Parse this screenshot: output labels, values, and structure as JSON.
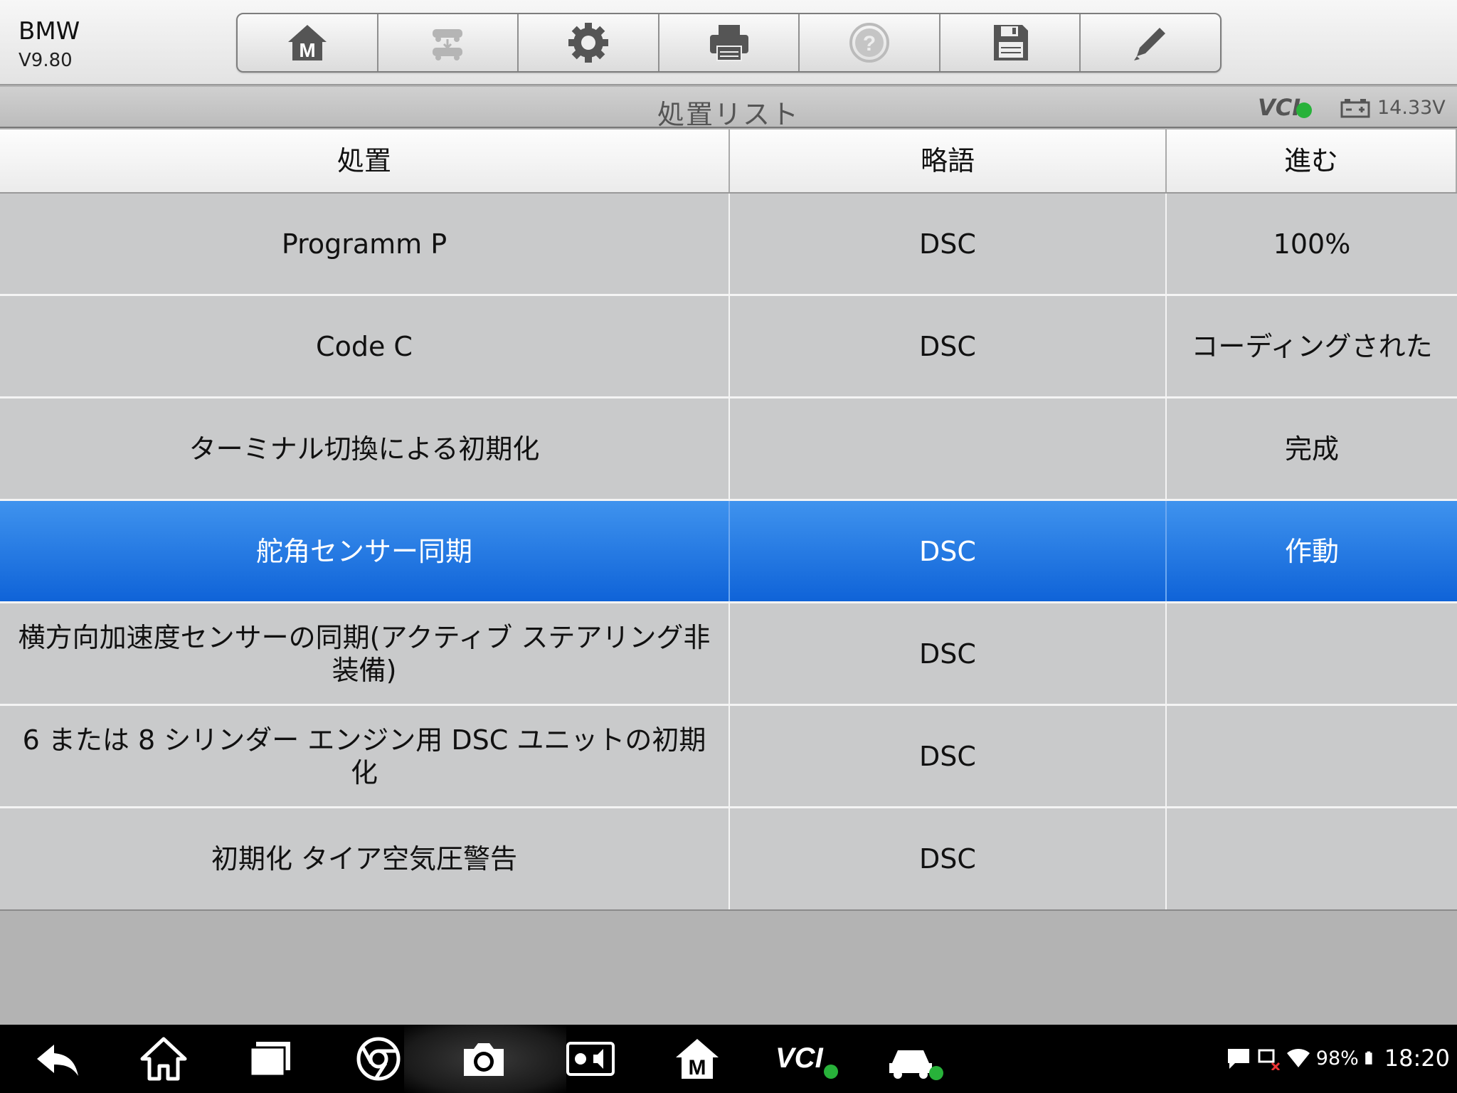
{
  "app": {
    "name": "BMW",
    "version": "V9.80"
  },
  "toolbar": {
    "buttons": [
      {
        "icon": "home-m-icon",
        "enabled": true
      },
      {
        "icon": "vehicle-swap-icon",
        "enabled": false
      },
      {
        "icon": "gear-icon",
        "enabled": true
      },
      {
        "icon": "printer-icon",
        "enabled": true
      },
      {
        "icon": "help-icon",
        "enabled": false
      },
      {
        "icon": "save-icon",
        "enabled": true
      },
      {
        "icon": "pencil-icon",
        "enabled": true
      }
    ]
  },
  "titlebar": {
    "title": "処置リスト",
    "vci_label": "VCI",
    "voltage": "14.33V"
  },
  "table": {
    "headers": [
      "処置",
      "略語",
      "進む"
    ],
    "rows": [
      {
        "action": "Programm P",
        "abbr": "DSC",
        "progress": "100%"
      },
      {
        "action": "Code C",
        "abbr": "DSC",
        "progress": "コーディングされた"
      },
      {
        "action": "ターミナル切換による初期化",
        "abbr": "",
        "progress": "完成"
      },
      {
        "action": "舵角センサー同期",
        "abbr": "DSC",
        "progress": "作動"
      },
      {
        "action": "横方向加速度センサーの同期(アクティブ ステアリング非装備)",
        "abbr": "DSC",
        "progress": ""
      },
      {
        "action": "6 または 8 シリンダー エンジン用 DSC ユニットの初期化",
        "abbr": "DSC",
        "progress": ""
      },
      {
        "action": "初期化 タイア空気圧警告",
        "abbr": "DSC",
        "progress": ""
      }
    ],
    "selected_index": 3
  },
  "navbar": {
    "buttons": [
      "back-icon",
      "home-icon",
      "recent-apps-icon",
      "chrome-icon",
      "camera-icon",
      "brightness-volume-icon",
      "maxisys-home-icon",
      "vci-icon",
      "car-icon"
    ],
    "battery": "98%",
    "time": "18:20"
  },
  "colors": {
    "selected_row": "#1f74e2",
    "row_bg": "#c9cacb",
    "background": "#b3b3b3"
  }
}
